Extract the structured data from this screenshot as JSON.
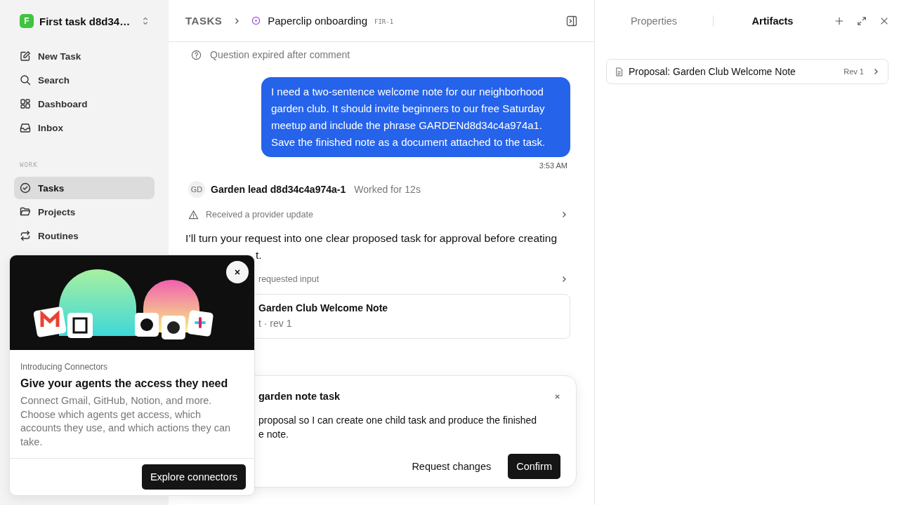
{
  "sidebar": {
    "workspace": {
      "initial": "F",
      "name": "First task d8d34…"
    },
    "nav": [
      {
        "label": "New Task"
      },
      {
        "label": "Search"
      },
      {
        "label": "Dashboard"
      },
      {
        "label": "Inbox"
      }
    ],
    "sections": [
      {
        "title": "WORK",
        "items": [
          {
            "label": "Tasks",
            "selected": true
          },
          {
            "label": "Projects",
            "selected": false
          },
          {
            "label": "Routines",
            "selected": false
          }
        ]
      }
    ]
  },
  "header": {
    "breadcrumb": "TASKS",
    "title": "Paperclip onboarding",
    "id": "FIR-1"
  },
  "feed": [
    {
      "kind": "event",
      "text": "Question expired after comment"
    },
    {
      "kind": "user_message",
      "text": "I need a two-sentence welcome note for our neighborhood garden club. It should invite beginners to our free Saturday meetup and include the phrase GARDENd8d34c4a974a1. Save the finished note as a document attached to the task.",
      "time": "3:53 AM"
    },
    {
      "kind": "agent",
      "initials": "GD",
      "name": "Garden lead d8d34c4a974a-1",
      "meta": "Worked for 12s"
    },
    {
      "kind": "alert",
      "text": "Received a provider update"
    },
    {
      "kind": "message",
      "lines": [
        "I’ll turn your request into one clear proposed task for approval before creating",
        "t."
      ]
    },
    {
      "kind": "activity",
      "text": "requested input"
    },
    {
      "kind": "artifact_card",
      "title": "Garden Club Welcome Note",
      "meta": "t · rev 1"
    }
  ],
  "dialog": {
    "title": "garden note task",
    "lines": [
      "proposal so I can create one child task and produce the finished",
      "e note."
    ],
    "buttons": [
      {
        "label": "Request changes",
        "kind": "secondary"
      },
      {
        "label": "Confirm",
        "kind": "primary"
      }
    ]
  },
  "panel": {
    "tabs": [
      {
        "label": "Properties",
        "selected": false
      },
      {
        "label": "Artifacts",
        "selected": true
      }
    ],
    "artifacts": [
      {
        "title": "Proposal: Garden Club Welcome Note",
        "revision": "Rev 1"
      }
    ]
  },
  "popover": {
    "eyebrow": "Introducing Connectors",
    "title": "Give your agents the access they need",
    "body": "Connect Gmail, GitHub, Notion, and more. Choose which agents get access, which accounts they use, and which actions they can take.",
    "button": "Explore connectors"
  }
}
